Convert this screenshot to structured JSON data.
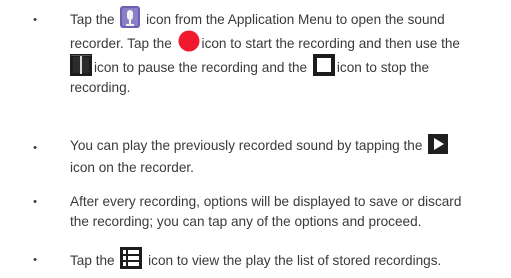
{
  "items": [
    {
      "lines": [
        {
          "segments": [
            {
              "t": "Tap the "
            },
            {
              "icon": "sound-recorder-app-icon"
            },
            {
              "t": " icon from the Application Menu to open the sound"
            }
          ]
        },
        {
          "segments": [
            {
              "t": "recorder. Tap the "
            },
            {
              "icon": "record-icon"
            },
            {
              "t": "icon to start the recording and then use the"
            }
          ]
        },
        {
          "segments": [
            {
              "icon": "pause-icon"
            },
            {
              "t": "icon to pause the recording and the "
            },
            {
              "icon": "stop-icon"
            },
            {
              "t": "icon to stop the"
            }
          ]
        },
        {
          "segments": [
            {
              "t": "recording."
            }
          ]
        }
      ]
    },
    {
      "lines": [
        {
          "segments": [
            {
              "t": "You can play the previously recorded sound by tapping the "
            },
            {
              "icon": "play-icon"
            }
          ]
        },
        {
          "segments": [
            {
              "t": "icon on the recorder."
            }
          ]
        }
      ]
    },
    {
      "lines": [
        {
          "segments": [
            {
              "t": "After every recording, options will be displayed to save or discard"
            }
          ]
        },
        {
          "segments": [
            {
              "t": "the recording; you can tap any of the options and proceed."
            }
          ]
        }
      ]
    },
    {
      "lines": [
        {
          "segments": [
            {
              "t": "Tap the "
            },
            {
              "icon": "list-icon"
            },
            {
              "t": " icon to view the play the list of stored recordings."
            }
          ]
        }
      ]
    }
  ],
  "bullet_char": "•",
  "colors": {
    "text": "#3a3a3a",
    "record": "#f0192e",
    "icon_dark": "#1c1c1c",
    "play_bg": "#1f1f1f",
    "app_icon": "#6b5fb0"
  }
}
